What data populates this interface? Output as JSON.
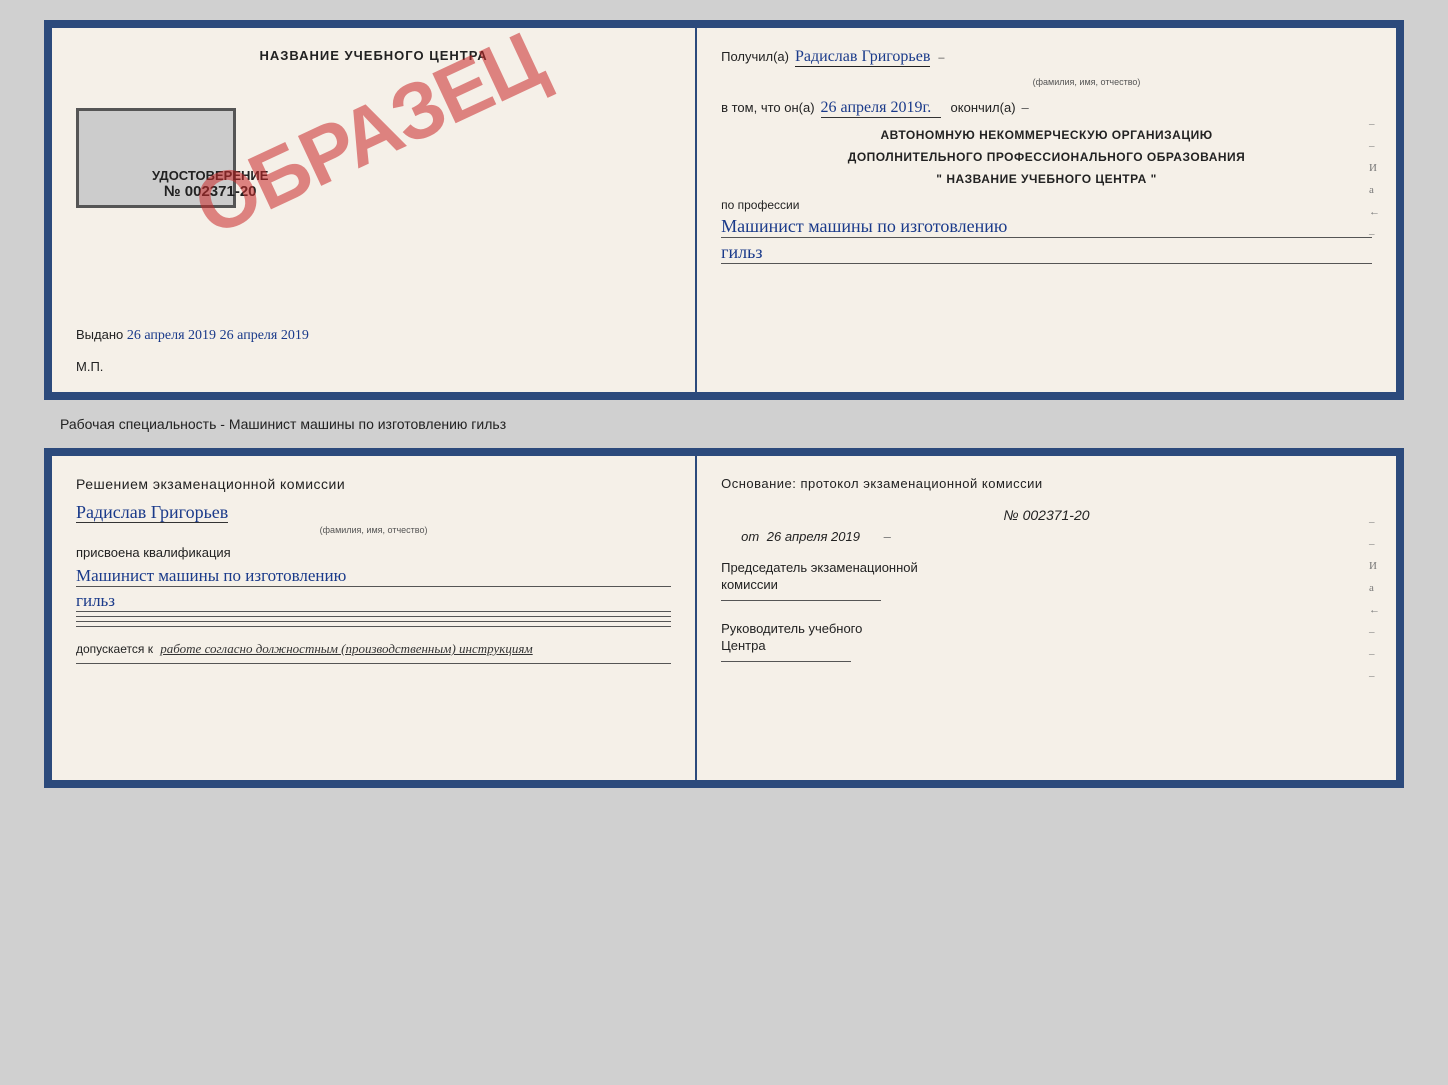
{
  "top_doc": {
    "left": {
      "title": "НАЗВАНИЕ УЧЕБНОГО ЦЕНТРА",
      "obrazec": "ОБРАЗЕЦ",
      "uds_title": "УДОСТОВЕРЕНИЕ",
      "uds_number": "№ 002371-20",
      "vydano_label": "Выдано",
      "vydano_date": "26 апреля 2019",
      "mp": "М.П."
    },
    "right": {
      "poluchil_label": "Получил(а)",
      "name_handwritten": "Радислав Григорьев",
      "fio_label": "(фамилия, имя, отчество)",
      "vtom_label": "в том, что он(а)",
      "date_handwritten": "26 апреля 2019г.",
      "okonchil_label": "окончил(а)",
      "org_line1": "АВТОНОМНУЮ НЕКОММЕРЧЕСКУЮ ОРГАНИЗАЦИЮ",
      "org_line2": "ДОПОЛНИТЕЛЬНОГО ПРОФЕССИОНАЛЬНОГО ОБРАЗОВАНИЯ",
      "org_line3": "\"  НАЗВАНИЕ УЧЕБНОГО ЦЕНТРА  \"",
      "po_professii": "по профессии",
      "profession_handwritten": "Машинист машины по изготовлению",
      "profession_line2_handwritten": "гильз"
    }
  },
  "section_label": "Рабочая специальность - Машинист машины по изготовлению гильз",
  "bottom_doc": {
    "left": {
      "resheniyem": "Решением  экзаменационной  комиссии",
      "name_handwritten": "Радислав Григорьев",
      "fio_label": "(фамилия, имя, отчество)",
      "prisvoena": "присвоена квалификация",
      "qual_handwritten": "Машинист  машины  по  изготовлению",
      "qual_line2_handwritten": "гильз",
      "dopuskaetsya": "допускается к",
      "dopusk_italic": "работе согласно должностным (производственным) инструкциям"
    },
    "right": {
      "osnovanie": "Основание:  протокол  экзаменационной  комиссии",
      "number": "№  002371-20",
      "ot_label": "от",
      "ot_date": "26 апреля 2019",
      "predsedatel_line1": "Председатель экзаменационной",
      "predsedatel_line2": "комиссии",
      "rukovoditel_line1": "Руководитель учебного",
      "rukovoditel_line2": "Центра"
    }
  },
  "side_markers": [
    "-",
    "И",
    "а",
    "←",
    "-",
    "-",
    "-"
  ]
}
